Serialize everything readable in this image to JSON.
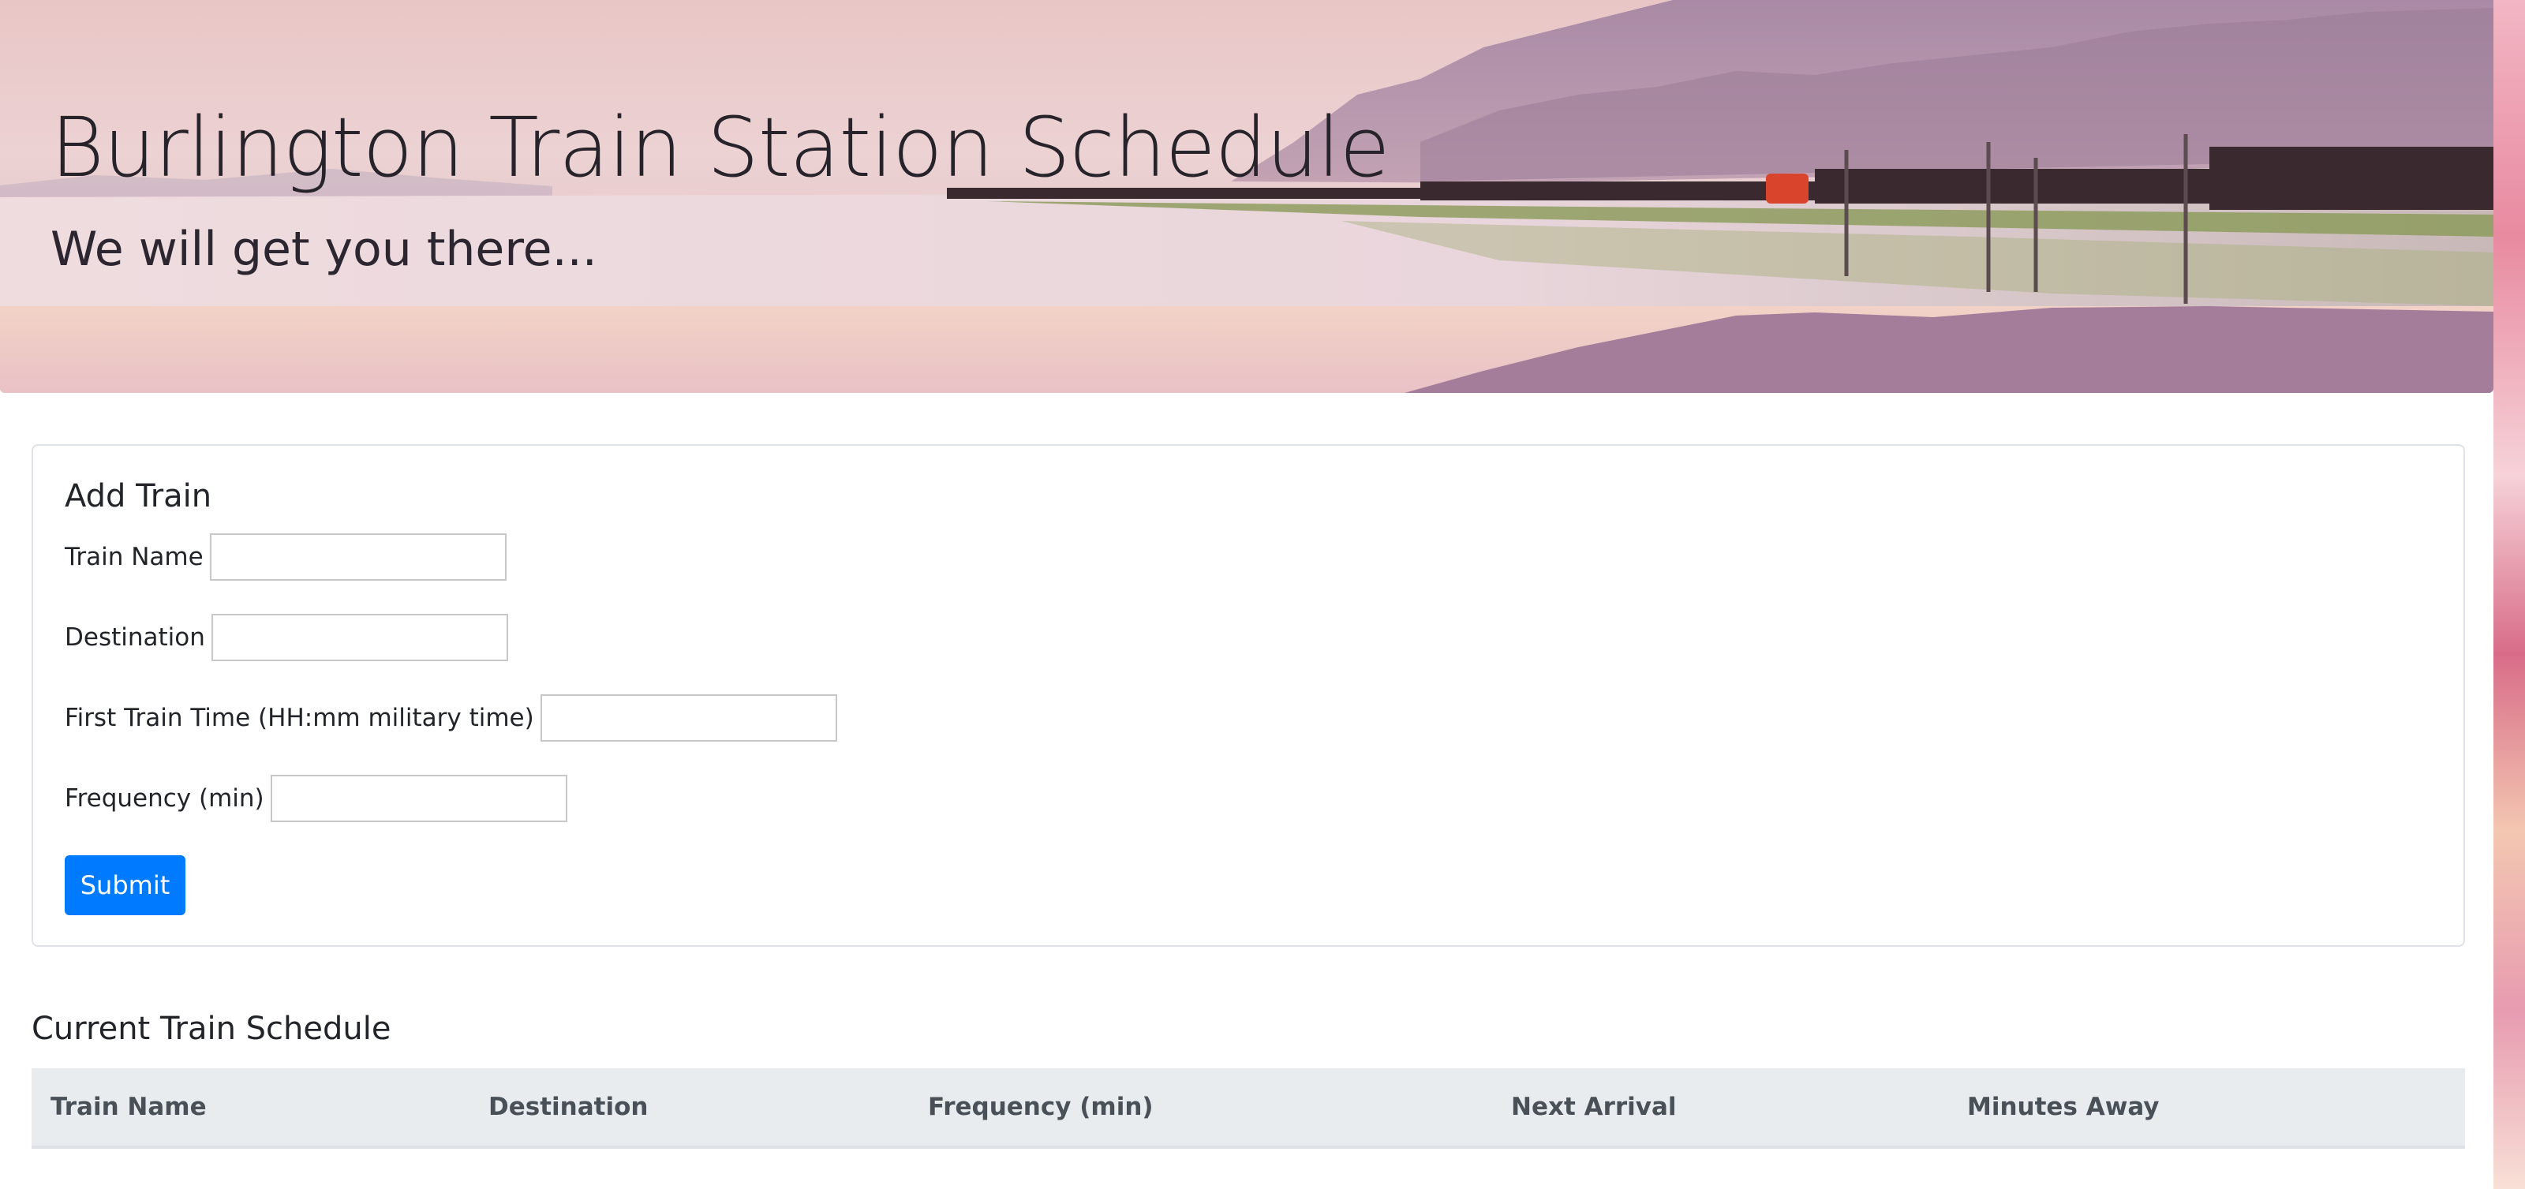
{
  "header": {
    "title": "Burlington Train Station Schedule",
    "subtitle": "We will get you there..."
  },
  "add_train": {
    "title": "Add Train",
    "fields": [
      {
        "label": "Train Name",
        "value": "",
        "placeholder": ""
      },
      {
        "label": "Destination",
        "value": "",
        "placeholder": ""
      },
      {
        "label": "First Train Time (HH:mm military time)",
        "value": "",
        "placeholder": ""
      },
      {
        "label": "Frequency (min)",
        "value": "",
        "placeholder": ""
      }
    ],
    "submit_label": "Submit"
  },
  "schedule": {
    "title": "Current Train Schedule",
    "columns": [
      "Train Name",
      "Destination",
      "Frequency (min)",
      "Next Arrival",
      "Minutes Away"
    ],
    "rows": []
  },
  "colors": {
    "primary_button": "#007bff",
    "table_header_bg": "#e9ecef",
    "text": "#212529",
    "table_header_text": "#495057"
  }
}
